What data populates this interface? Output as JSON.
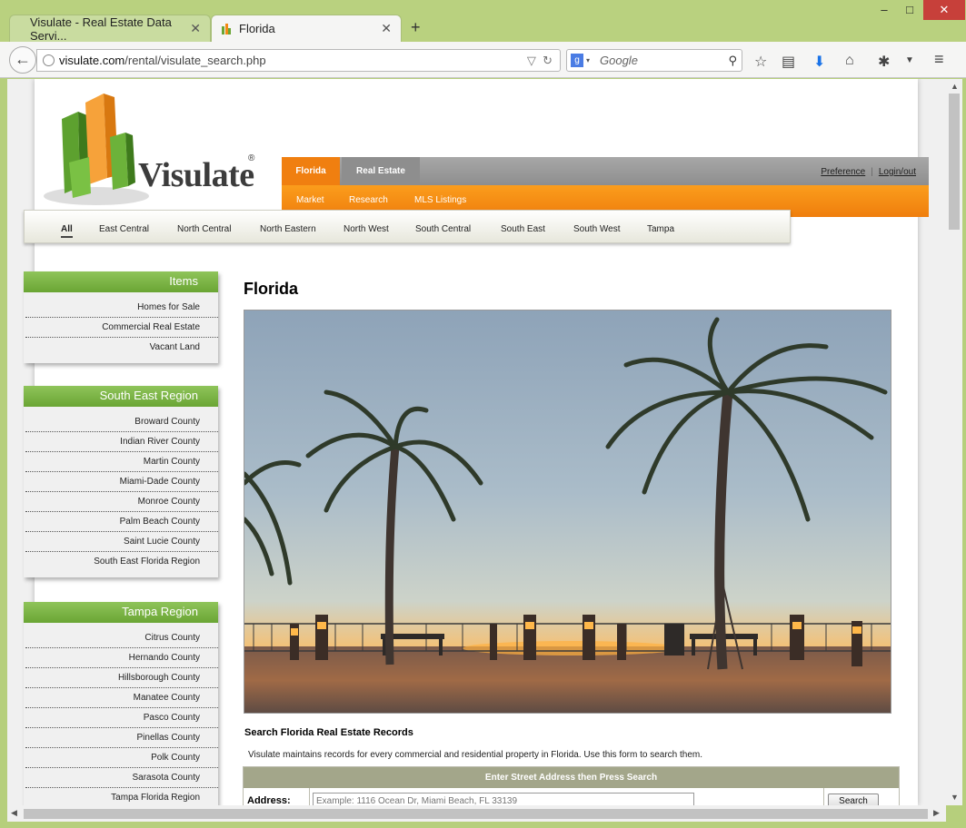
{
  "browser": {
    "tabs": [
      {
        "title": "Visulate - Real Estate Data Servi...",
        "active": false
      },
      {
        "title": "Florida",
        "active": true
      }
    ],
    "url_host": "visulate.com",
    "url_path": "/rental/visulate_search.php",
    "search_placeholder": "Google",
    "window_controls": {
      "minimize": "–",
      "maximize": "□",
      "close": "✕"
    },
    "toolbar_icons": [
      "star-icon",
      "reading-list-icon",
      "download-icon",
      "home-icon",
      "extension-icon",
      "menu-icon"
    ]
  },
  "site": {
    "logo_text": "Visulate",
    "logo_reg": "®",
    "topmenu": {
      "tabs": [
        "Florida",
        "Real Estate"
      ],
      "subtabs": [
        "Market",
        "Research",
        "MLS Listings"
      ],
      "links": [
        "Preference",
        "Login/out"
      ],
      "separator": "|"
    },
    "regions": [
      "All",
      "East Central",
      "North Central",
      "North Eastern",
      "North West",
      "South Central",
      "South East",
      "South West",
      "Tampa"
    ]
  },
  "sidebar": [
    {
      "title": "Items",
      "items": [
        "Homes for Sale",
        "Commercial Real Estate",
        "Vacant Land"
      ]
    },
    {
      "title": "South East Region",
      "items": [
        "Broward County",
        "Indian River County",
        "Martin County",
        "Miami-Dade County",
        "Monroe County",
        "Palm Beach County",
        "Saint Lucie County",
        "South East Florida Region"
      ]
    },
    {
      "title": "Tampa Region",
      "items": [
        "Citrus County",
        "Hernando County",
        "Hillsborough County",
        "Manatee County",
        "Pasco County",
        "Pinellas County",
        "Polk County",
        "Sarasota County",
        "Tampa Florida Region"
      ]
    }
  ],
  "main": {
    "title": "Florida",
    "section_title": "Search Florida Real Estate Records",
    "section_desc": "Visulate maintains records for every commercial and residential property in Florida. Use this form to search them.",
    "form": {
      "header": "Enter Street Address then Press Search",
      "address_label": "Address:",
      "address_placeholder": "Example: 1116 Ocean Dr, Miami Beach, FL 33139",
      "search_label": "Search"
    }
  },
  "colors": {
    "accent_orange": "#f28a12",
    "accent_green": "#78b241",
    "browser_frame": "#b6cf7c"
  }
}
